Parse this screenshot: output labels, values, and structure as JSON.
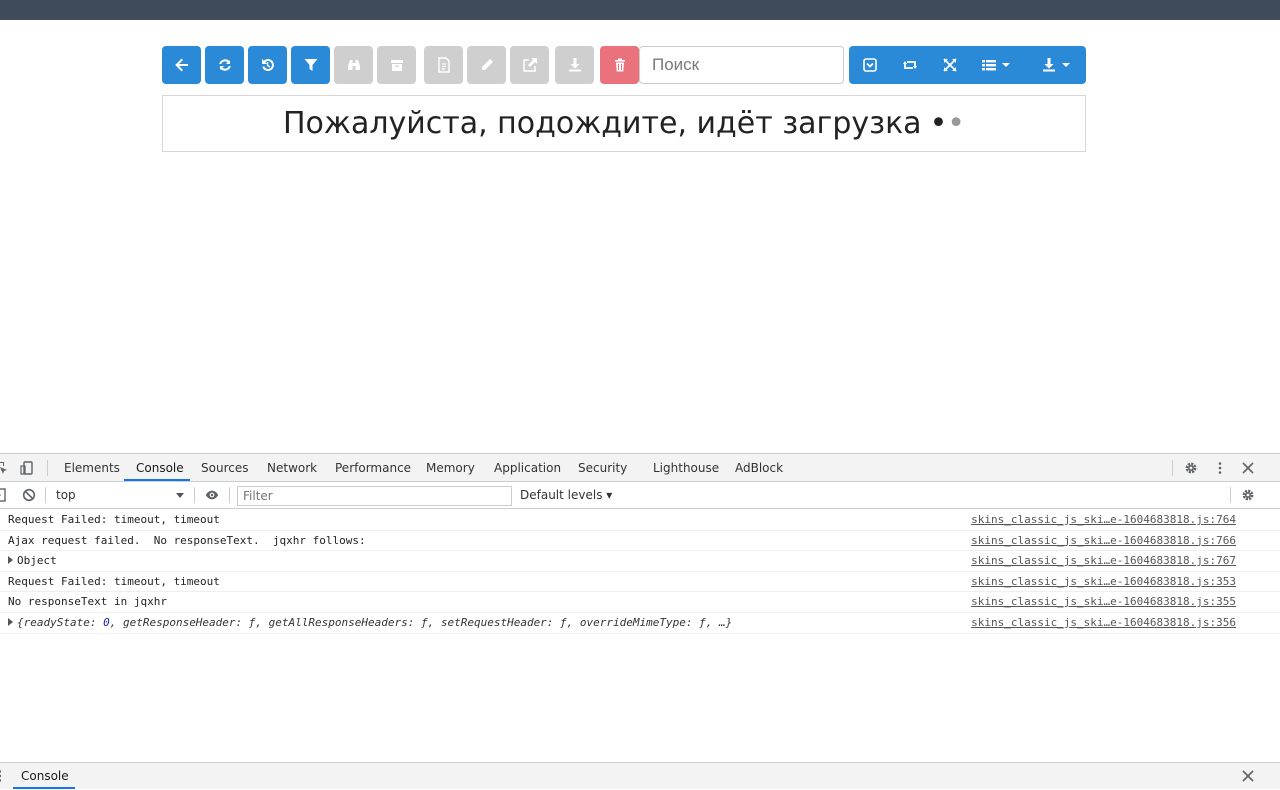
{
  "toolbar": {
    "search_placeholder": "Поиск",
    "buttons": [
      {
        "icon": "arrow-left-icon",
        "state": "enabled",
        "color": "#2b8ad8"
      },
      {
        "icon": "refresh-icon",
        "state": "enabled",
        "color": "#2b8ad8"
      },
      {
        "icon": "undo-icon",
        "state": "enabled",
        "color": "#2b8ad8"
      },
      {
        "icon": "filter-icon",
        "state": "enabled",
        "color": "#2b8ad8"
      },
      {
        "icon": "binoculars-icon",
        "state": "disabled",
        "color": "#cfcfcf"
      },
      {
        "icon": "archive-icon",
        "state": "disabled",
        "color": "#cfcfcf"
      },
      {
        "icon": "document-icon",
        "state": "disabled",
        "color": "#cfcfcf"
      },
      {
        "icon": "pencil-icon",
        "state": "disabled",
        "color": "#cfcfcf"
      },
      {
        "icon": "external-link-icon",
        "state": "disabled",
        "color": "#cfcfcf"
      },
      {
        "icon": "download-icon",
        "state": "disabled",
        "color": "#cfcfcf"
      },
      {
        "icon": "trash-icon",
        "state": "enabled",
        "color": "#e9727d"
      }
    ],
    "right_group": [
      "collapse-icon",
      "retweet-icon",
      "fullscreen-icon",
      "list-columns-icon",
      "export-download-icon"
    ]
  },
  "loading": {
    "text": "Пожалуйста, подождите, идёт загрузка",
    "dots": [
      "•",
      "•"
    ]
  },
  "devtools": {
    "tabs": [
      "Elements",
      "Console",
      "Sources",
      "Network",
      "Performance",
      "Memory",
      "Application",
      "Security",
      "Lighthouse",
      "AdBlock"
    ],
    "active_tab": "Console",
    "context": "top",
    "filter_placeholder": "Filter",
    "levels_label": "Default levels ▾",
    "messages": [
      {
        "text": "Request Failed: timeout, timeout",
        "source": "skins_classic_js_ski…e-1604683818.js:764"
      },
      {
        "text": "Ajax request failed.  No responseText.  jqxhr follows:",
        "source": "skins_classic_js_ski…e-1604683818.js:766"
      },
      {
        "text": "Object",
        "source": "skins_classic_js_ski…e-1604683818.js:767",
        "expandable": true
      },
      {
        "text": "Request Failed: timeout, timeout",
        "source": "skins_classic_js_ski…e-1604683818.js:353"
      },
      {
        "text": "No responseText in jqxhr",
        "source": "skins_classic_js_ski…e-1604683818.js:355"
      },
      {
        "text_pre": "{readyState: ",
        "text_num": "0",
        "text_post": ", getResponseHeader: ƒ, getAllResponseHeaders: ƒ, setRequestHeader: ƒ, overrideMimeType: ƒ, …}",
        "source": "skins_classic_js_ski…e-1604683818.js:356",
        "expandable": true
      }
    ],
    "drawer_tab": "Console"
  }
}
